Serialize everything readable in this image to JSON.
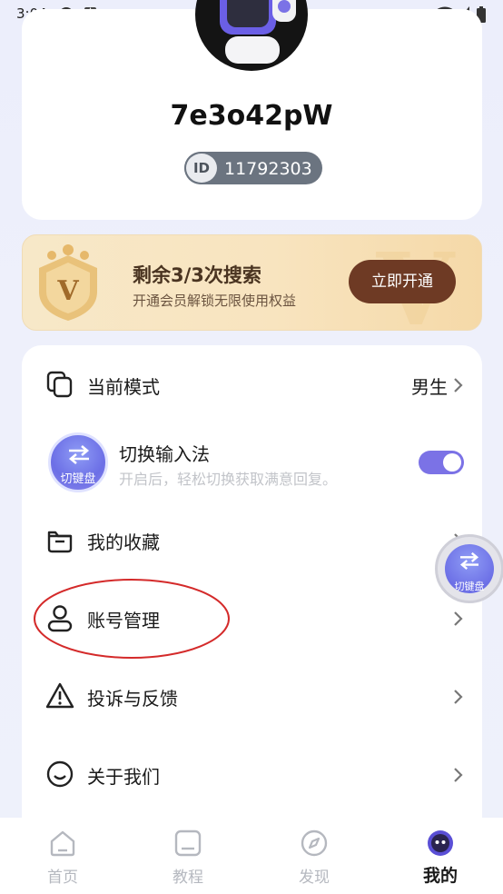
{
  "status_bar": {
    "time": "3:04"
  },
  "profile": {
    "username": "7e3o42pW",
    "id_badge": "ID",
    "id_number": "11792303"
  },
  "vip": {
    "title": "剩余3/3次搜索",
    "subtitle": "开通会员解锁无限使用权益",
    "button": "立即开通",
    "medal_letter": "V"
  },
  "menu": {
    "current_mode_label": "当前模式",
    "current_mode_value": "男生",
    "switch_ime_title": "切换输入法",
    "switch_ime_sub": "开启后，轻松切换获取满意回复。",
    "switch_ime_icon_text": "切键盘",
    "switch_ime_on": true,
    "favorites_label": "我的收藏",
    "account_label": "账号管理",
    "feedback_label": "投诉与反馈",
    "about_label": "关于我们"
  },
  "floating_button": {
    "text": "切键盘"
  },
  "bottom_nav": {
    "items": [
      {
        "label": "首页",
        "icon": "home-icon"
      },
      {
        "label": "教程",
        "icon": "tutorial-icon"
      },
      {
        "label": "发现",
        "icon": "compass-icon"
      },
      {
        "label": "我的",
        "icon": "profile-icon",
        "active": true
      }
    ]
  },
  "colors": {
    "accent": "#7b72e6",
    "vip_button": "#6e3a24",
    "annotation": "#d42a2a"
  }
}
